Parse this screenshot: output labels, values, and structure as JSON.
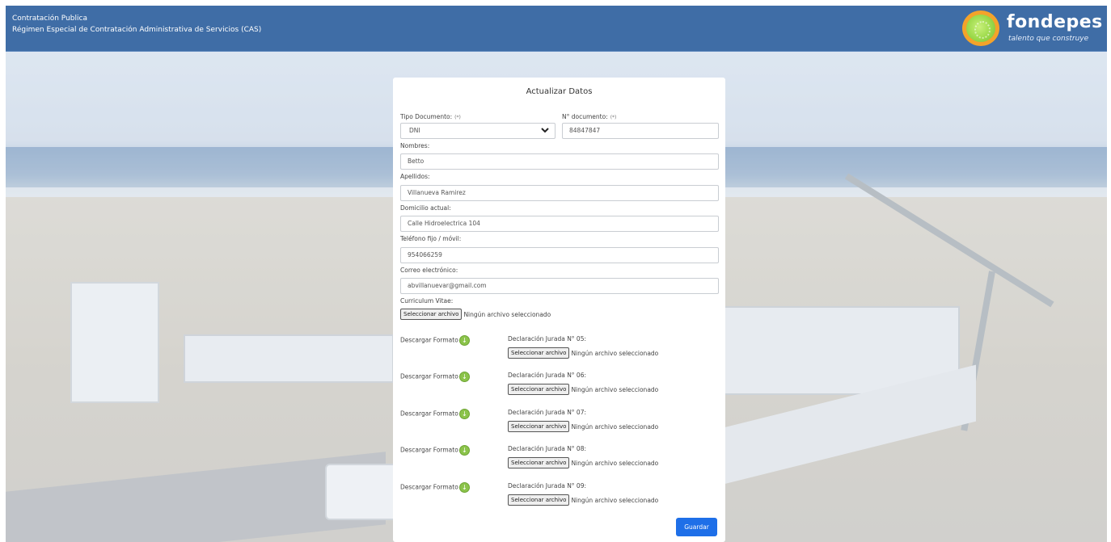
{
  "header": {
    "line1": "Contratación Publica",
    "line2": "Régimen Especial de Contratación Administrativa de Servicios (CAS)",
    "logo_text": "fondepes",
    "logo_tagline": "talento que construye"
  },
  "form": {
    "title": "Actualizar Datos",
    "required_mark": "(*)",
    "tipo_documento": {
      "label": "Tipo Documento:",
      "value": "DNI"
    },
    "nro_documento": {
      "label": "N° documento:",
      "value": "84847847"
    },
    "nombres": {
      "label": "Nombres:",
      "value": "Betto"
    },
    "apellidos": {
      "label": "Apellidos:",
      "value": "Villanueva Ramirez"
    },
    "domicilio": {
      "label": "Domicilio actual:",
      "value": "Calle Hidroelectrica 104"
    },
    "telefono": {
      "label": "Teléfono fijo / móvil:",
      "value": "954066259"
    },
    "correo": {
      "label": "Correo electrónico:",
      "value": "abvillanuevar@gmail.com"
    },
    "cv": {
      "label": "Curriculum Vitae:"
    },
    "file_button_label": "Seleccionar archivo",
    "file_status": "Ningún archivo seleccionado",
    "download_label": "Descargar Formato",
    "declaraciones": [
      {
        "label": "Declaración Jurada N° 05:"
      },
      {
        "label": "Declaración Jurada N° 06:"
      },
      {
        "label": "Declaración Jurada N° 07:"
      },
      {
        "label": "Declaración Jurada N° 08:"
      },
      {
        "label": "Declaración Jurada N° 09:"
      }
    ],
    "save_label": "Guardar"
  },
  "colors": {
    "header_bg": "#3f6da6",
    "save_button": "#1e6fe8",
    "download_icon": "#8bc34a",
    "logo_ring": "#f4a32a"
  },
  "icons": {
    "select_arrow": "chevron-down-icon",
    "download": "download-arrow-icon",
    "logo": "fondepes-logo-icon"
  }
}
